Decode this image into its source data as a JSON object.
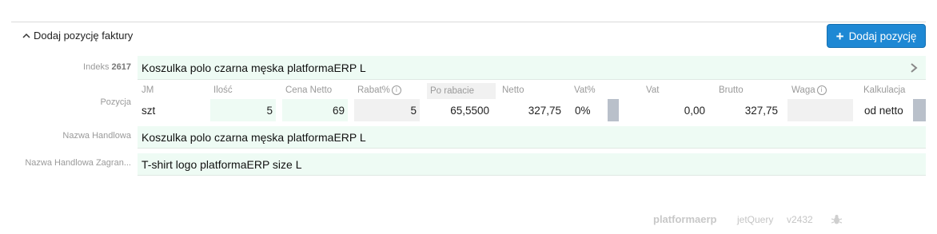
{
  "section": {
    "title": "Dodaj pozycję faktury"
  },
  "actions": {
    "add_label": "Dodaj pozycję"
  },
  "indeks": {
    "label": "Indeks",
    "number": "2617",
    "value": "Koszulka polo czarna męska platformaERP L"
  },
  "pozycja": {
    "label": "Pozycja",
    "headers": {
      "jm": "JM",
      "ilosc": "Ilość",
      "cena_netto": "Cena Netto",
      "rabat": "Rabat%",
      "po_rabacie": "Po rabacie",
      "netto": "Netto",
      "vat_pct": "Vat%",
      "vat": "Vat",
      "brutto": "Brutto",
      "waga": "Waga",
      "kalkulacja": "Kalkulacja"
    },
    "values": {
      "jm": "szt",
      "ilosc": "5",
      "cena_netto": "69",
      "rabat": "5",
      "po_rabacie": "65,5500",
      "netto": "327,75",
      "vat_pct": "0%",
      "vat": "0,00",
      "brutto": "327,75",
      "waga": "",
      "kalkulacja": "od netto"
    }
  },
  "nazwa_handlowa": {
    "label": "Nazwa Handlowa",
    "value": "Koszulka polo czarna męska platformaERP L"
  },
  "nazwa_handlowa_zagr": {
    "label": "Nazwa Handlowa Zagran...",
    "value": "T-shirt  logo platformaERP size L"
  },
  "footer": {
    "brand": "platformaerp",
    "lib": "jetQuery",
    "version": "v2432"
  },
  "colors": {
    "accent": "#1e88d4",
    "field_bg": "#eefbf4"
  }
}
